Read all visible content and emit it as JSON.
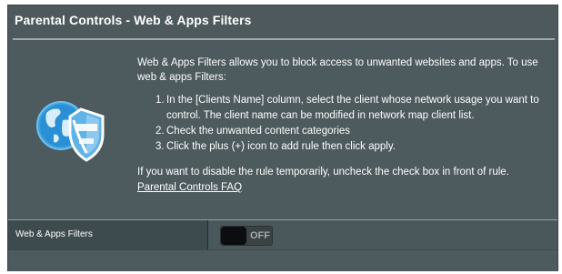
{
  "header": {
    "title": "Parental Controls - Web & Apps Filters"
  },
  "icon": {
    "globe_color": "#2b8fd3",
    "shield_color": "#8ec8ef"
  },
  "description": {
    "intro": "Web & Apps Filters allows you to block access to unwanted websites and apps. To use web & apps Filters:",
    "steps": [
      {
        "num": "1.",
        "text": "In the [Clients Name] column, select the client whose network usage you want to control. The client name can be modified in network map client list."
      },
      {
        "num": "2.",
        "text": "Check the unwanted content categories"
      },
      {
        "num": "3.",
        "text": "Click the plus (+) icon to add rule then click apply."
      }
    ],
    "note": "If you want to disable the rule temporarily, uncheck the check box in front of rule.",
    "faq_link": "Parental Controls FAQ"
  },
  "setting": {
    "label": "Web & Apps Filters",
    "toggle_state": "OFF"
  }
}
